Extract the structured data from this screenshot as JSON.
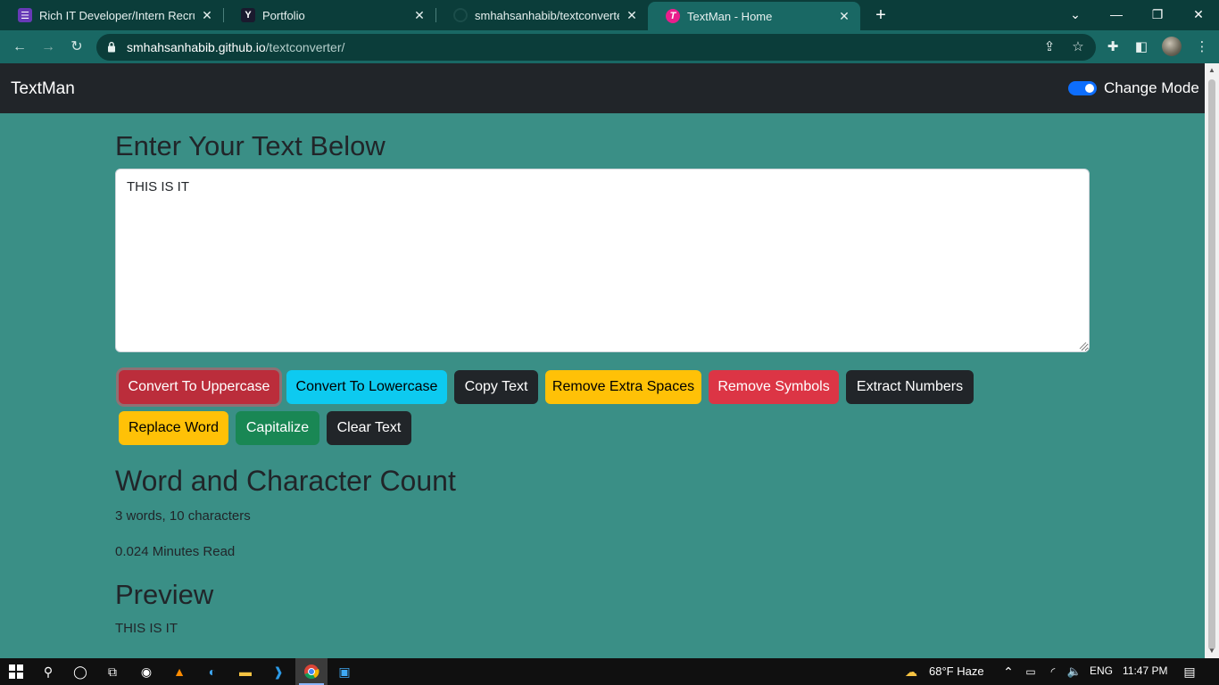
{
  "browser": {
    "tabs": [
      {
        "title": "Rich IT Developer/Intern Recruitm",
        "favicon": "form-icon",
        "color": "#673ab7"
      },
      {
        "title": "Portfolio",
        "favicon": "Y",
        "color": "#1a1a2e"
      },
      {
        "title": "smhahsanhabib/textconverter",
        "favicon": "github-icon",
        "color": "#0b3d3a"
      },
      {
        "title": "TextMan - Home",
        "favicon": "T",
        "color": "#e91e8c"
      }
    ],
    "url_domain": "smhahsanhabib.github.io",
    "url_path": "/textconverter/"
  },
  "app": {
    "brand": "TextMan",
    "mode_label": "Change Mode",
    "mode_enabled": true
  },
  "main": {
    "heading": "Enter Your Text Below",
    "textarea_value": "THIS IS IT",
    "buttons": [
      {
        "label": "Convert To Uppercase",
        "variant": "danger"
      },
      {
        "label": "Convert To Lowercase",
        "variant": "info"
      },
      {
        "label": "Copy Text",
        "variant": "dark"
      },
      {
        "label": "Remove Extra Spaces",
        "variant": "warning"
      },
      {
        "label": "Remove Symbols",
        "variant": "danger"
      },
      {
        "label": "Extract Numbers",
        "variant": "dark"
      },
      {
        "label": "Replace Word",
        "variant": "warning"
      },
      {
        "label": "Capitalize",
        "variant": "success"
      },
      {
        "label": "Clear Text",
        "variant": "dark"
      }
    ],
    "count_heading": "Word and Character Count",
    "count_text": "3 words, 10 characters",
    "read_text": "0.024 Minutes Read",
    "preview_heading": "Preview",
    "preview_text": "THIS IS IT"
  },
  "taskbar": {
    "weather": "68°F  Haze",
    "language": "ENG",
    "time": "11:47 PM"
  },
  "colors": {
    "page_bg": "#3a8f86",
    "navbar_bg": "#212529",
    "chrome_dark": "#0b3d3a",
    "chrome_toolbar": "#196864"
  }
}
